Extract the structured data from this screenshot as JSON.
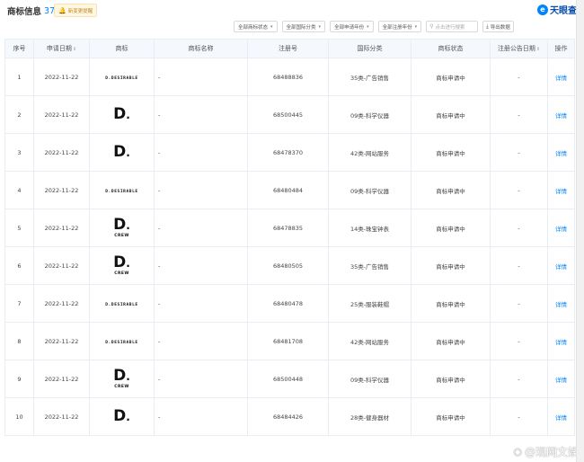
{
  "header": {
    "title": "商标信息",
    "count": "37",
    "alert_label": "新变更提醒",
    "brand": "天眼查"
  },
  "filters": [
    {
      "label": "全部商标状态"
    },
    {
      "label": "全部国际分类"
    },
    {
      "label": "全部申请年份"
    },
    {
      "label": "全部注册年份"
    }
  ],
  "search": {
    "placeholder": "点击进行搜索"
  },
  "export_label": "导出数据",
  "table": {
    "headers": {
      "seq": "序号",
      "date": "申请日期",
      "logo": "商标",
      "name": "商标名称",
      "reg": "注册号",
      "class": "国际分类",
      "status": "商标状态",
      "pub": "注册公告日期",
      "op": "操作"
    },
    "rows": [
      {
        "seq": "1",
        "date": "2022-11-22",
        "logo": "text",
        "logo_text": "D.DESIRABLE",
        "name": "-",
        "reg": "68488836",
        "class": "35类-广告销售",
        "status": "商标申请中",
        "pub": "-",
        "op": "详情"
      },
      {
        "seq": "2",
        "date": "2022-11-22",
        "logo": "d",
        "name": "-",
        "reg": "68500445",
        "class": "09类-科学仪器",
        "status": "商标申请中",
        "pub": "-",
        "op": "详情"
      },
      {
        "seq": "3",
        "date": "2022-11-22",
        "logo": "d",
        "name": "-",
        "reg": "68478370",
        "class": "42类-网站服务",
        "status": "商标申请中",
        "pub": "-",
        "op": "详情"
      },
      {
        "seq": "4",
        "date": "2022-11-22",
        "logo": "text",
        "logo_text": "D.DESIRABLE",
        "name": "-",
        "reg": "68480484",
        "class": "09类-科学仪器",
        "status": "商标申请中",
        "pub": "-",
        "op": "详情"
      },
      {
        "seq": "5",
        "date": "2022-11-22",
        "logo": "crew",
        "logo_text": "CREW",
        "name": "-",
        "reg": "68478835",
        "class": "14类-珠宝钟表",
        "status": "商标申请中",
        "pub": "-",
        "op": "详情"
      },
      {
        "seq": "6",
        "date": "2022-11-22",
        "logo": "crew",
        "logo_text": "CREW",
        "name": "-",
        "reg": "68480505",
        "class": "35类-广告销售",
        "status": "商标申请中",
        "pub": "-",
        "op": "详情"
      },
      {
        "seq": "7",
        "date": "2022-11-22",
        "logo": "text",
        "logo_text": "D.DESIRABLE",
        "name": "-",
        "reg": "68480478",
        "class": "25类-服装鞋帽",
        "status": "商标申请中",
        "pub": "-",
        "op": "详情"
      },
      {
        "seq": "8",
        "date": "2022-11-22",
        "logo": "text",
        "logo_text": "D.DESIRABLE",
        "name": "-",
        "reg": "68481708",
        "class": "42类-网站服务",
        "status": "商标申请中",
        "pub": "-",
        "op": "详情"
      },
      {
        "seq": "9",
        "date": "2022-11-22",
        "logo": "crew",
        "logo_text": "CREW",
        "name": "-",
        "reg": "68500448",
        "class": "09类-科学仪器",
        "status": "商标申请中",
        "pub": "-",
        "op": "详情"
      },
      {
        "seq": "10",
        "date": "2022-11-22",
        "logo": "d",
        "name": "-",
        "reg": "68484426",
        "class": "28类-健身器材",
        "status": "商标申请中",
        "pub": "-",
        "op": "详情"
      }
    ]
  },
  "watermark": "@观网文娱",
  "colors": {
    "accent": "#0084ff",
    "header_bg": "#f5f8fc",
    "alert_bg": "#fff7e6"
  },
  "icons": {
    "alert": "bell-icon",
    "search": "search-icon",
    "export": "download-icon",
    "brand": "tianyancha-logo-icon",
    "watermark": "weibo-icon"
  }
}
